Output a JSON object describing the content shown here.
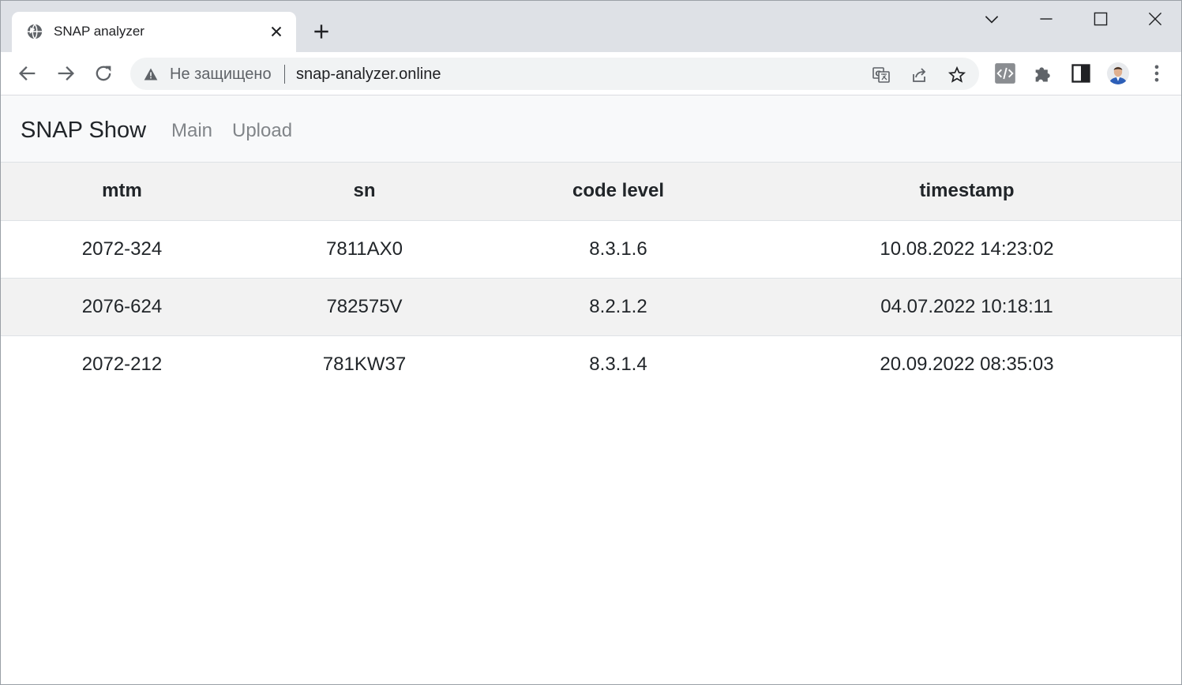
{
  "browser": {
    "tab_title": "SNAP analyzer",
    "security_label": "Не защищено",
    "url": "snap-analyzer.online"
  },
  "navbar": {
    "brand": "SNAP Show",
    "links": [
      "Main",
      "Upload"
    ]
  },
  "table": {
    "headers": [
      "mtm",
      "sn",
      "code level",
      "timestamp"
    ],
    "rows": [
      [
        "2072-324",
        "7811AX0",
        "8.3.1.6",
        "10.08.2022 14:23:02"
      ],
      [
        "2076-624",
        "782575V",
        "8.2.1.2",
        "04.07.2022 10:18:11"
      ],
      [
        "2072-212",
        "781KW37",
        "8.3.1.4",
        "20.09.2022 08:35:03"
      ]
    ]
  },
  "icons": {
    "favicon": "globe-icon",
    "tab_close": "close-icon",
    "new_tab": "plus-icon",
    "back": "arrow-left-icon",
    "forward": "arrow-right-icon",
    "reload": "reload-icon",
    "security": "warning-triangle-icon",
    "translate": "translate-icon",
    "share": "share-icon",
    "bookmark": "star-icon",
    "devtools": "code-icon",
    "extensions": "puzzle-icon",
    "side_panel": "side-panel-icon",
    "menu": "kebab-menu-icon"
  },
  "colors": {
    "tabstrip": "#dee1e6",
    "navbar_bg": "#f8f9fa",
    "stripe_bg": "#f2f2f2",
    "nav_link": "#818589"
  }
}
